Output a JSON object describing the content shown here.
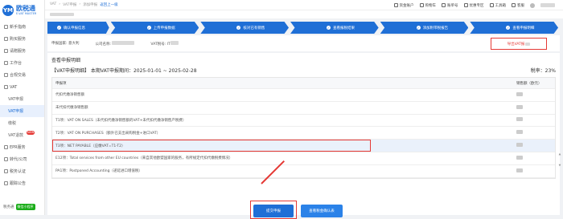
{
  "app": {
    "logo_mark": "YM",
    "name": "欧税通",
    "name_en": "E-VAT MASTER"
  },
  "sidebar": {
    "items": [
      {
        "label": "新手指南",
        "sub": false,
        "active": false
      },
      {
        "label": "购买服务",
        "sub": false,
        "active": false
      },
      {
        "label": "请赠服务",
        "sub": false,
        "active": false
      },
      {
        "label": "工作台",
        "sub": false,
        "active": false
      },
      {
        "label": "合规交易",
        "sub": false,
        "active": false
      },
      {
        "label": "VAT",
        "sub": false,
        "active": false
      },
      {
        "label": "VAT申报",
        "sub": true,
        "active": false
      },
      {
        "label": "VAT申报",
        "sub": true,
        "active": true
      },
      {
        "label": "缴税",
        "sub": true,
        "active": false
      },
      {
        "label": "VAT退款",
        "sub": true,
        "active": false,
        "badge": "NEW"
      },
      {
        "label": "EPR服务",
        "sub": false,
        "active": false
      },
      {
        "label": "转代/公司",
        "sub": false,
        "active": false
      },
      {
        "label": "税务认证",
        "sub": false,
        "active": false
      },
      {
        "label": "跟踪公告",
        "sub": false,
        "active": false
      }
    ],
    "bottom_label": "税务通",
    "wechat_label": "微信小程序"
  },
  "breadcrumb": {
    "items": [
      "VAT",
      "VAT申报",
      "添加申报"
    ],
    "back": "返回上一级"
  },
  "topbar": {
    "items": [
      {
        "label": "资金账户",
        "icon": "wallet-icon"
      },
      {
        "label": "购物车",
        "icon": "cart-icon"
      },
      {
        "label": "账单号",
        "icon": "bill-icon"
      },
      {
        "label": "优惠专区",
        "icon": "coupon-icon"
      },
      {
        "label": "工具箱",
        "icon": "toolbox-icon"
      },
      {
        "label": "客服",
        "icon": "headset-icon"
      }
    ]
  },
  "steps": [
    {
      "label": "确认申报信息"
    },
    {
      "label": "上传申报数据"
    },
    {
      "label": "核对已有销售"
    },
    {
      "label": "查看报税结果"
    },
    {
      "label": "添加附带税报告"
    },
    {
      "label": "查看申报明细"
    }
  ],
  "info": {
    "country_label": "申报国家: 意大利",
    "company_label": "公司名称:",
    "vat_label": "VAT税号: IT",
    "export_button": "导出VAT报"
  },
  "main": {
    "title": "查看申报明细",
    "period": "【VAT申报明细】  本期VAT申报期间：2025-01-01 ~ 2025-02-28",
    "rate": "税率：23%",
    "table": {
      "col1": "申报项",
      "col2": "销售额（欧元）",
      "rows": [
        {
          "label": "代扣代缴净销售额",
          "highlight": false
        },
        {
          "label": "未代扣代缴净销售额",
          "highlight": false
        },
        {
          "label": "T1项：VAT ON SALES（未代扣代缴净销售额的VAT+未代扣代缴净销售产税费）",
          "highlight": false
        },
        {
          "label": "T2项：VAT ON PURCHASES（额外已支出采购税金+进口VAT）",
          "highlight": false
        },
        {
          "label": "T3项：NET PAYABLE（应缴VAT=T1-T2）",
          "highlight": true
        },
        {
          "label": "E12项：Total services from other EU countries（来自其他欧盟国家的服务，有所规定代扣代缴税费情况）",
          "highlight": false
        },
        {
          "label": "PA1项：Postponed Accounting（递延进口增值税）",
          "highlight": false
        }
      ]
    },
    "submit_button": "提交申报",
    "confirm_button": "查看税金确认表"
  },
  "colors": {
    "primary": "#1f6fd6",
    "alert": "#e53935"
  }
}
